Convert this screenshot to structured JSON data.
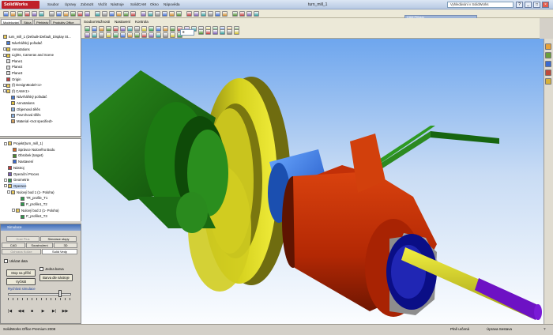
{
  "window": {
    "brand": "SolidWorks",
    "document_title": "turn_mill_1",
    "search_placeholder": "Vyhledávání v SolidWorks",
    "buttons": [
      "?",
      "_",
      "□",
      "×"
    ]
  },
  "main_menu": [
    "Soubor",
    "Úpravy",
    "Zobrazit",
    "Vložit",
    "Nástroje",
    "SolidCAM",
    "Okno",
    "Nápověda"
  ],
  "cam_panel": {
    "title": "CAM Příkazy",
    "button_colors": [
      "#2d5bb3",
      "#4a8a2f",
      "#b33a2d",
      "#3b8f8f",
      "#7a5cb0",
      "#2f9a4e",
      "#c08a20",
      "#2d5bb3",
      "#8a3a8a",
      "#d06a2a",
      "#3a6ad0"
    ]
  },
  "left_tabs": [
    "Modelování",
    "Skica",
    "Přehledy",
    "Produkty Office"
  ],
  "feature_tree": {
    "root": "turn_mill_1 (Default<Default_Display St...",
    "items": [
      "Návrhářský pořadač",
      "Annotations",
      "Lights, Cameras and Scene",
      "Plane1",
      "Plane2",
      "Plane3",
      "Origin",
      "(f) DesignModel<1>",
      "(f) CAM<1>",
      "Návrhářský pořadač",
      "Annotations",
      "Objemová tělěs",
      "Povrchová tělěs",
      "Material <not specified>"
    ]
  },
  "cam_tree": {
    "items": [
      "Projekt(turn_mill_1)",
      "Správce Nulového Bodu",
      "Obrobek (target)",
      "Nastavení",
      "Nástroj",
      "Operační Proces",
      "Geometrie",
      "Operace",
      "Nulový bod 1 (1- Poloha)",
      "TR_profile_T1",
      "P_profile1_T2",
      "Nulový bod 2 (1- Poloha)",
      "P_profile2_T3"
    ]
  },
  "simulation": {
    "title": "Simulace",
    "tabs_row1": [
      "Host Plus",
      "Simulace stopy"
    ],
    "tabs_row2": [
      "CAD",
      "Soustružení",
      "3D"
    ],
    "tabs_row3": [
      "Ochrana Kolize",
      "Solid Vedy"
    ],
    "checkbox_transparent": "Ukázat data",
    "stop_button": "Stop na příští",
    "one_color_label": "Jedna barva",
    "reset_button": "Vyčistit",
    "tool_color_button": "Barva dle nástroje",
    "speed_label": "Rychlost simulace",
    "speed_level": 0.85,
    "player_buttons": [
      "|◀",
      "◀◀",
      "■",
      "▶",
      "▶|",
      "▶▶"
    ]
  },
  "viewport_menu": [
    "Soubor",
    "Možnosti",
    "Nastavení",
    "Kontrola"
  ],
  "viewport_dropdown": "8",
  "model_colors": {
    "chuck": "#cbc822",
    "chuck_dark": "#7d7a12",
    "spindle": "#1f6f14",
    "spindle_dark": "#0f3f09",
    "part": "#c12d06",
    "part_dark": "#7d1b03",
    "blue": "#2a71e0",
    "navy": "#0b108a",
    "rod": "#dbd917",
    "purple": "#6f0fbf",
    "grey": "#8e8e8e",
    "bracket": "#1d6e16"
  },
  "status": {
    "product": "SolidWorks Office Premium 2008",
    "state": "Plně určená",
    "mode": "Úprava Sestava",
    "help": "?"
  }
}
